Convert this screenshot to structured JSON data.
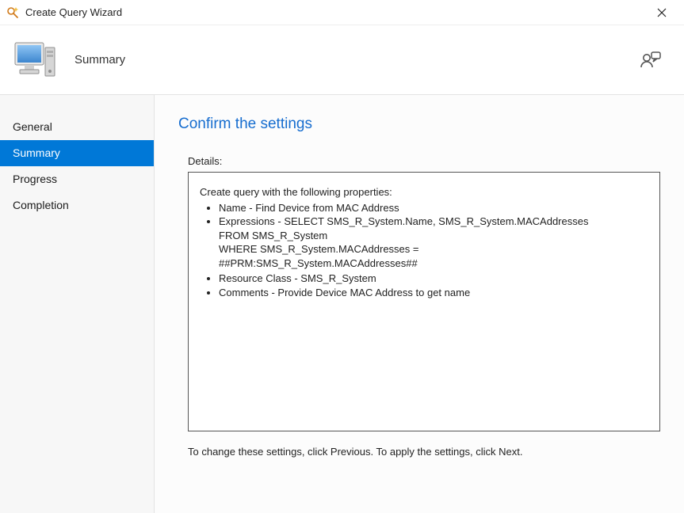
{
  "window": {
    "title": "Create Query Wizard"
  },
  "header": {
    "page_title": "Summary"
  },
  "sidebar": {
    "items": [
      {
        "label": "General",
        "selected": false
      },
      {
        "label": "Summary",
        "selected": true
      },
      {
        "label": "Progress",
        "selected": false
      },
      {
        "label": "Completion",
        "selected": false
      }
    ]
  },
  "content": {
    "heading": "Confirm the settings",
    "details_label": "Details:",
    "intro": "Create query with the following properties:",
    "items": {
      "name": "Name - Find Device from MAC Address",
      "expressions_line1": "Expressions - SELECT SMS_R_System.Name, SMS_R_System.MACAddresses",
      "expressions_line2": "FROM  SMS_R_System",
      "expressions_line3": "WHERE SMS_R_System.MACAddresses =",
      "expressions_line4": "##PRM:SMS_R_System.MACAddresses##",
      "resource_class": "Resource Class - SMS_R_System",
      "comments": "Comments - Provide Device MAC Address to get name"
    },
    "footer_note": "To change these settings, click Previous. To apply the settings, click Next."
  },
  "colors": {
    "accent": "#0078d7",
    "heading": "#166dcf"
  }
}
